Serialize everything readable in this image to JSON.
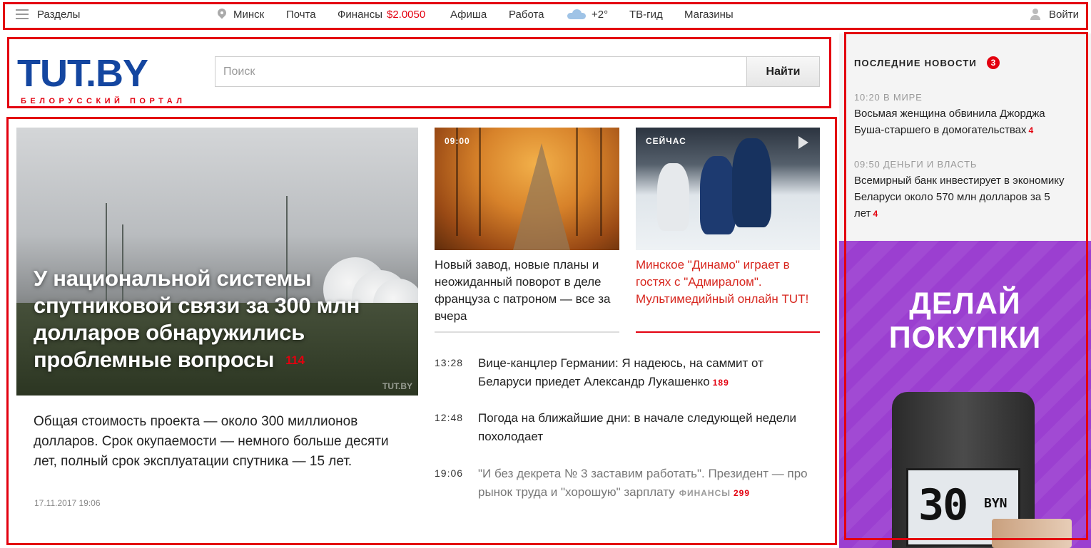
{
  "topbar": {
    "sections": "Разделы",
    "city": "Минск",
    "mail": "Почта",
    "finance": "Финансы",
    "finance_rate": "$2.0050",
    "afisha": "Афиша",
    "jobs": "Работа",
    "weather": "+2°",
    "tv": "ТВ-гид",
    "shops": "Магазины",
    "login": "Войти"
  },
  "logo": {
    "main": "TUT.BY",
    "subtitle": "БЕЛОРУССКИЙ ПОРТАЛ"
  },
  "search": {
    "placeholder": "Поиск",
    "button": "Найти"
  },
  "lead": {
    "title": "У национальной системы спутниковой связи за 300 млн долларов обнаружились проблемные вопросы",
    "comments": "114",
    "description": "Общая стоимость проекта — около 300 миллионов долларов. Срок окупаемости — немного больше десяти лет, полный срок эксплуатации спутника — 15 лет.",
    "date": "17.11.2017 19:06",
    "watermark": "TUT.BY"
  },
  "cards": [
    {
      "badge": "09:00",
      "title": "Новый завод, новые планы и неожиданный поворот в деле француза с патроном — все за вчера",
      "color": "#222222",
      "separator": "#dddddd"
    },
    {
      "badge": "СЕЙЧАС",
      "title": "Минское \"Динамо\" играет в гостях с \"Адмиралом\". Мультимедийный онлайн TUT!",
      "color": "#d7261e",
      "separator": "#e3000f"
    }
  ],
  "news": [
    {
      "time": "13:28",
      "title": "Вице-канцлер Германии: Я надеюсь, на саммит от Беларуси приедет Александр Лукашенко",
      "comments": "189",
      "rubric": ""
    },
    {
      "time": "12:48",
      "title": "Погода на ближайшие дни: в начале следующей недели похолодает",
      "comments": "",
      "rubric": ""
    },
    {
      "time": "19:06",
      "title": "\"И без декрета № 3 заставим работать\". Президент — про рынок труда и \"хорошую\" зарплату",
      "comments": "299",
      "rubric": "ФИНАНСЫ"
    }
  ],
  "sidebar": {
    "heading": "ПОСЛЕДНИЕ НОВОСТИ",
    "unread": "3",
    "items": [
      {
        "meta": "10:20 В МИРЕ",
        "title": "Восьмая женщина обвинила Джорджа Буша-старшего в домогательствах",
        "comments": "4"
      },
      {
        "meta": "09:50 ДЕНЬГИ И ВЛАСТЬ",
        "title": "Всемирный банк инвестирует в экономику Беларуси около 570 млн долларов за 5 лет",
        "comments": "4"
      }
    ]
  },
  "ad": {
    "title_line1": "ДЕЛАЙ",
    "title_line2": "ПОКУПКИ",
    "amount": "30",
    "currency": "BYN"
  },
  "colors": {
    "accent": "#e3000f",
    "brand_blue": "#1446a0",
    "ad_purple": "#9b3fd0"
  }
}
